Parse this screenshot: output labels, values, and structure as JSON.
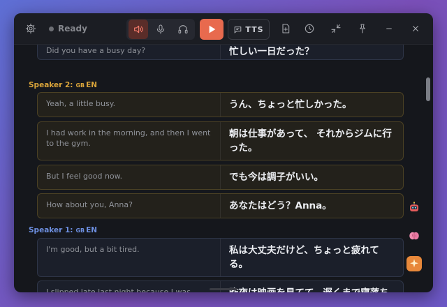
{
  "status": {
    "text": "Ready"
  },
  "toolbar": {
    "tts_label": "TTS"
  },
  "icons": {
    "settings": "gear-icon",
    "speaker": "speaker-icon",
    "mic": "microphone-icon",
    "headphones": "headphones-icon",
    "play": "play-icon",
    "tts": "message-icon",
    "add": "add-file-icon",
    "history": "clock-icon",
    "collapse": "collapse-icon",
    "pin": "pin-icon",
    "minimize": "minimize-icon",
    "close": "close-icon"
  },
  "colors": {
    "speaker2": "#d9a43a",
    "speaker1": "#6d8fe0",
    "play": "#e86a4e"
  },
  "conversation": [
    {
      "type": "card",
      "speaker": 1,
      "source": "Did you have a busy day?",
      "target": "忙しい一日だった？"
    },
    {
      "type": "header",
      "speaker": 2,
      "label": "Speaker 2:",
      "flag": "GB",
      "lang": "EN"
    },
    {
      "type": "card",
      "speaker": 2,
      "source": "Yeah, a little busy.",
      "target": "うん、ちょっと忙しかった。"
    },
    {
      "type": "card",
      "speaker": 2,
      "source": "I had work in the morning, and then I went to the gym.",
      "target": "朝は仕事があって、 それからジムに行った。"
    },
    {
      "type": "card",
      "speaker": 2,
      "source": "But I feel good now.",
      "target": "でも今は調子がいい。"
    },
    {
      "type": "card",
      "speaker": 2,
      "source": "How about you, Anna?",
      "target": "あなたはどう？Anna。"
    },
    {
      "type": "header",
      "speaker": 1,
      "label": "Speaker 1:",
      "flag": "GB",
      "lang": "EN"
    },
    {
      "type": "card",
      "speaker": 1,
      "source": "I'm good, but a bit tired.",
      "target": "私は大丈夫だけど、ちょっと疲れてる。"
    },
    {
      "type": "card",
      "speaker": 1,
      "source": "I slipped late last night because I was watching a movie.",
      "target": "昨夜は映画を見てて、遅くまで寝落ちしちゃった。"
    }
  ],
  "floating": [
    {
      "name": "robot-icon"
    },
    {
      "name": "brain-icon"
    },
    {
      "name": "sparkle-icon"
    }
  ]
}
